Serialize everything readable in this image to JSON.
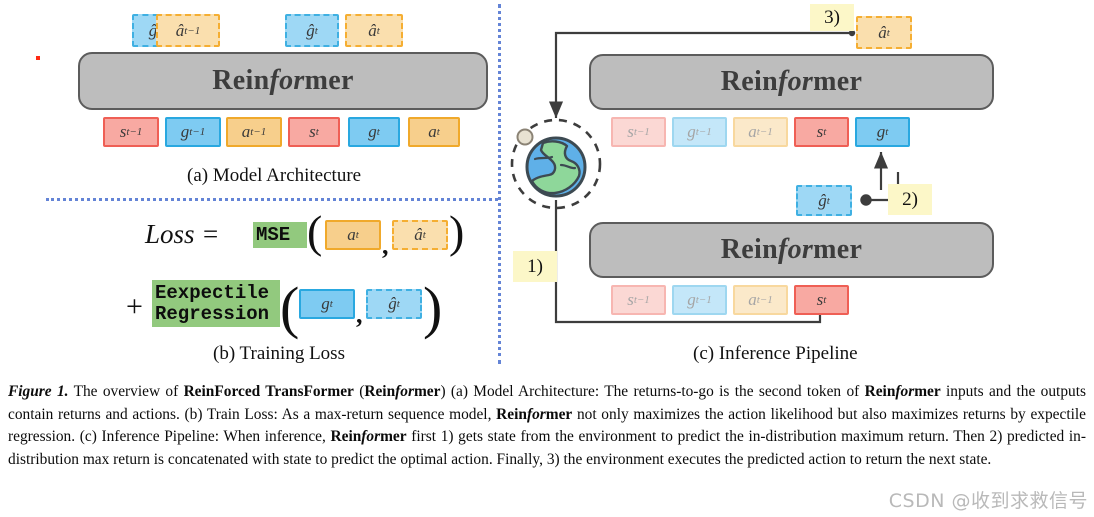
{
  "figure": {
    "panels": [
      {
        "id": "a",
        "caption": "(a) Model Architecture"
      },
      {
        "id": "b",
        "caption": "(b) Training Loss"
      },
      {
        "id": "c",
        "caption": "(c) Inference Pipeline"
      }
    ],
    "model_block_label": {
      "prefix": "Rein",
      "italic": "for",
      "suffix": "mer"
    },
    "architecture": {
      "output_tokens": [
        {
          "name": "g-hat-t-minus-1",
          "base": "ĝ",
          "sub": "t−1",
          "type": "return-hat"
        },
        {
          "name": "a-hat-t-minus-1",
          "base": "â",
          "sub": "t−1",
          "type": "action-hat"
        },
        {
          "name": "g-hat-t",
          "base": "ĝ",
          "sub": "t",
          "type": "return-hat"
        },
        {
          "name": "a-hat-t",
          "base": "â",
          "sub": "t",
          "type": "action-hat"
        }
      ],
      "input_tokens": [
        {
          "name": "s-t-minus-1",
          "base": "s",
          "sub": "t−1",
          "type": "state"
        },
        {
          "name": "g-t-minus-1",
          "base": "g",
          "sub": "t−1",
          "type": "return"
        },
        {
          "name": "a-t-minus-1",
          "base": "a",
          "sub": "t−1",
          "type": "action"
        },
        {
          "name": "s-t",
          "base": "s",
          "sub": "t",
          "type": "state"
        },
        {
          "name": "g-t",
          "base": "g",
          "sub": "t",
          "type": "return"
        },
        {
          "name": "a-t",
          "base": "a",
          "sub": "t",
          "type": "action"
        }
      ]
    },
    "loss": {
      "loss_word": "Loss",
      "equals": "=",
      "plus": "+",
      "term1_fn": "MSE",
      "term1_args": [
        {
          "name": "a-t",
          "base": "a",
          "sub": "t",
          "type": "action"
        },
        {
          "name": "a-hat-t",
          "base": "â",
          "sub": "t",
          "type": "action-hat"
        }
      ],
      "term2_fn_line1": "Eexpectile",
      "term2_fn_line2": "Regression",
      "term2_args": [
        {
          "name": "g-t",
          "base": "g",
          "sub": "t",
          "type": "return"
        },
        {
          "name": "g-hat-t",
          "base": "ĝ",
          "sub": "t",
          "type": "return-hat"
        }
      ],
      "comma": ",",
      "paren_open": "(",
      "paren_close": ")"
    },
    "inference": {
      "steps": [
        {
          "name": "step-1",
          "label": "1)"
        },
        {
          "name": "step-2",
          "label": "2)"
        },
        {
          "name": "step-3",
          "label": "3)"
        }
      ],
      "top_output_token": {
        "name": "a-hat-t",
        "base": "â",
        "sub": "t",
        "type": "action-hat"
      },
      "top_input_tokens": [
        {
          "name": "s-t-minus-1",
          "base": "s",
          "sub": "t−1",
          "type": "state",
          "faded": true
        },
        {
          "name": "g-t-minus-1",
          "base": "g",
          "sub": "t−1",
          "type": "return",
          "faded": true
        },
        {
          "name": "a-t-minus-1",
          "base": "a",
          "sub": "t−1",
          "type": "action",
          "faded": true
        },
        {
          "name": "s-t",
          "base": "s",
          "sub": "t",
          "type": "state",
          "faded": false
        },
        {
          "name": "g-t",
          "base": "g",
          "sub": "t",
          "type": "return",
          "faded": false
        }
      ],
      "middle_token": {
        "name": "g-hat-t",
        "base": "ĝ",
        "sub": "t",
        "type": "return-hat"
      },
      "bottom_input_tokens": [
        {
          "name": "s-t-minus-1",
          "base": "s",
          "sub": "t−1",
          "type": "state",
          "faded": true
        },
        {
          "name": "g-t-minus-1",
          "base": "g",
          "sub": "t−1",
          "type": "return",
          "faded": true
        },
        {
          "name": "a-t-minus-1",
          "base": "a",
          "sub": "t−1",
          "type": "action",
          "faded": true
        },
        {
          "name": "s-t",
          "base": "s",
          "sub": "t",
          "type": "state",
          "faded": false
        }
      ],
      "environment_icon": "globe-icon"
    }
  },
  "caption": {
    "figure_label": "Figure 1.",
    "text_full": "The overview of ReinForced TransFormer (Reinformer) (a) Model Architecture: The returns-to-go is the second token of Reinformer inputs and the outputs contain returns and actions. (b) Train Loss: As a max-return sequence model, Reinformer not only maximizes the action likelihood but also maximizes returns by expectile regression. (c) Inference Pipeline: When inference, Reinformer first 1) gets state from the environment to predict the in-distribution maximum return. Then 2) predicted in-distribution max return is concatenated with state to predict the optimal action. Finally, 3) the environment executes the predicted action to return the next state."
  },
  "watermark": {
    "text": "CSDN @收到求救信号"
  },
  "colors": {
    "state": "#f8a9a2",
    "state_border": "#ef5f55",
    "return": "#7ecbf2",
    "return_border": "#29a8e0",
    "action": "#f7cf8c",
    "action_border": "#f0a92b",
    "model_block": "#bdbdbd",
    "model_border": "#5c5c5c",
    "fn_highlight": "#92c97e",
    "step_highlight": "#fcf7c8",
    "divider": "#4a6fd0"
  }
}
